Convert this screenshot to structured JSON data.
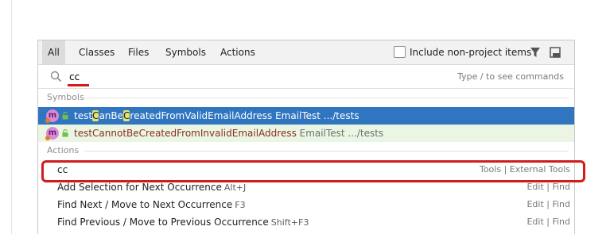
{
  "tabs": [
    "All",
    "Classes",
    "Files",
    "Symbols",
    "Actions"
  ],
  "active_tab": "All",
  "include_non_project": {
    "label": "Include non-project items",
    "checked": false
  },
  "search": {
    "value": "cc",
    "hint": "Type / to see commands"
  },
  "sections": {
    "symbols": "Symbols",
    "actions": "Actions"
  },
  "symbols": [
    {
      "badge": "m",
      "name_parts": [
        "test",
        "C",
        "anBe",
        "C",
        "reatedFromValidEmailAddress"
      ],
      "location": " EmailTest .../tests",
      "selected": true
    },
    {
      "badge": "m",
      "name": "testCannotBeCreatedFromInvalidEmailAddress",
      "location": " EmailTest .../tests",
      "selected": false
    }
  ],
  "actions": [
    {
      "label": "cc",
      "shortcut": "",
      "group": "Tools | External Tools"
    },
    {
      "label": "Add Selection for Next Occurrence",
      "shortcut": "Alt+J",
      "group": "Edit | Find"
    },
    {
      "label": "Find Next / Move to Next Occurrence",
      "shortcut": "F3",
      "group": "Edit | Find"
    },
    {
      "label": "Find Previous / Move to Previous Occurrence",
      "shortcut": "Shift+F3",
      "group": "Edit | Find"
    }
  ],
  "icons": {
    "search": "search-icon",
    "filter": "filter-icon",
    "preview": "preview-panel-icon",
    "method": "method-icon",
    "lock": "lock-icon"
  },
  "colors": {
    "selection": "#2f75c0",
    "highlight_match": "#e0e27a",
    "annotation_red": "#d21c1c"
  }
}
